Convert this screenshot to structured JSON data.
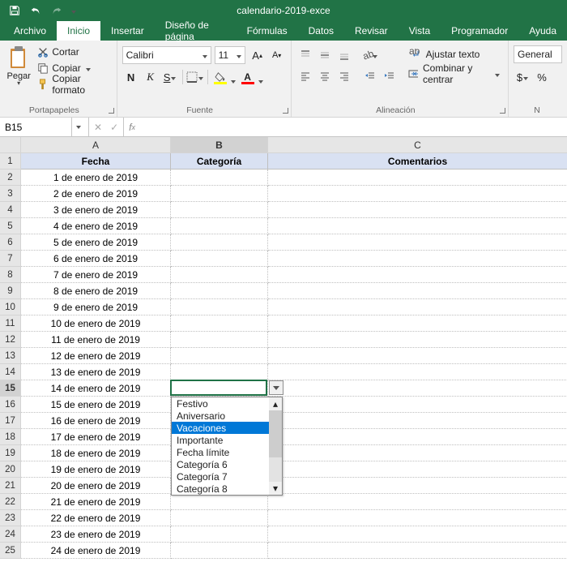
{
  "title": "calendario-2019-exce",
  "tabs": [
    "Archivo",
    "Inicio",
    "Insertar",
    "Diseño de página",
    "Fórmulas",
    "Datos",
    "Revisar",
    "Vista",
    "Programador",
    "Ayuda"
  ],
  "active_tab": "Inicio",
  "ribbon": {
    "clipboard": {
      "paste": "Pegar",
      "cut": "Cortar",
      "copy": "Copiar",
      "format": "Copiar formato",
      "label": "Portapapeles"
    },
    "font": {
      "name": "Calibri",
      "size": "11",
      "label": "Fuente"
    },
    "align": {
      "wrap": "Ajustar texto",
      "merge": "Combinar y centrar",
      "label": "Alineación"
    },
    "number": {
      "format": "General",
      "label": "N"
    }
  },
  "namebox": "B15",
  "columns": [
    "A",
    "B",
    "C"
  ],
  "headers": {
    "A": "Fecha",
    "B": "Categoría",
    "C": "Comentarios"
  },
  "rows": [
    "1 de enero de 2019",
    "2 de enero de 2019",
    "3 de enero de 2019",
    "4 de enero de 2019",
    "5 de enero de 2019",
    "6 de enero de 2019",
    "7 de enero de 2019",
    "8 de enero de 2019",
    "9 de enero de 2019",
    "10 de enero de 2019",
    "11 de enero de 2019",
    "12 de enero de 2019",
    "13 de enero de 2019",
    "14 de enero de 2019",
    "15 de enero de 2019",
    "16 de enero de 2019",
    "17 de enero de 2019",
    "18 de enero de 2019",
    "19 de enero de 2019",
    "20 de enero de 2019",
    "21 de enero de 2019",
    "22 de enero de 2019",
    "23 de enero de 2019",
    "24 de enero de 2019"
  ],
  "dropdown": {
    "items": [
      "Festivo",
      "Aniversario",
      "Vacaciones",
      "Importante",
      "Fecha límite",
      "Categoría 6",
      "Categoría 7",
      "Categoría 8"
    ],
    "highlighted": 2
  }
}
